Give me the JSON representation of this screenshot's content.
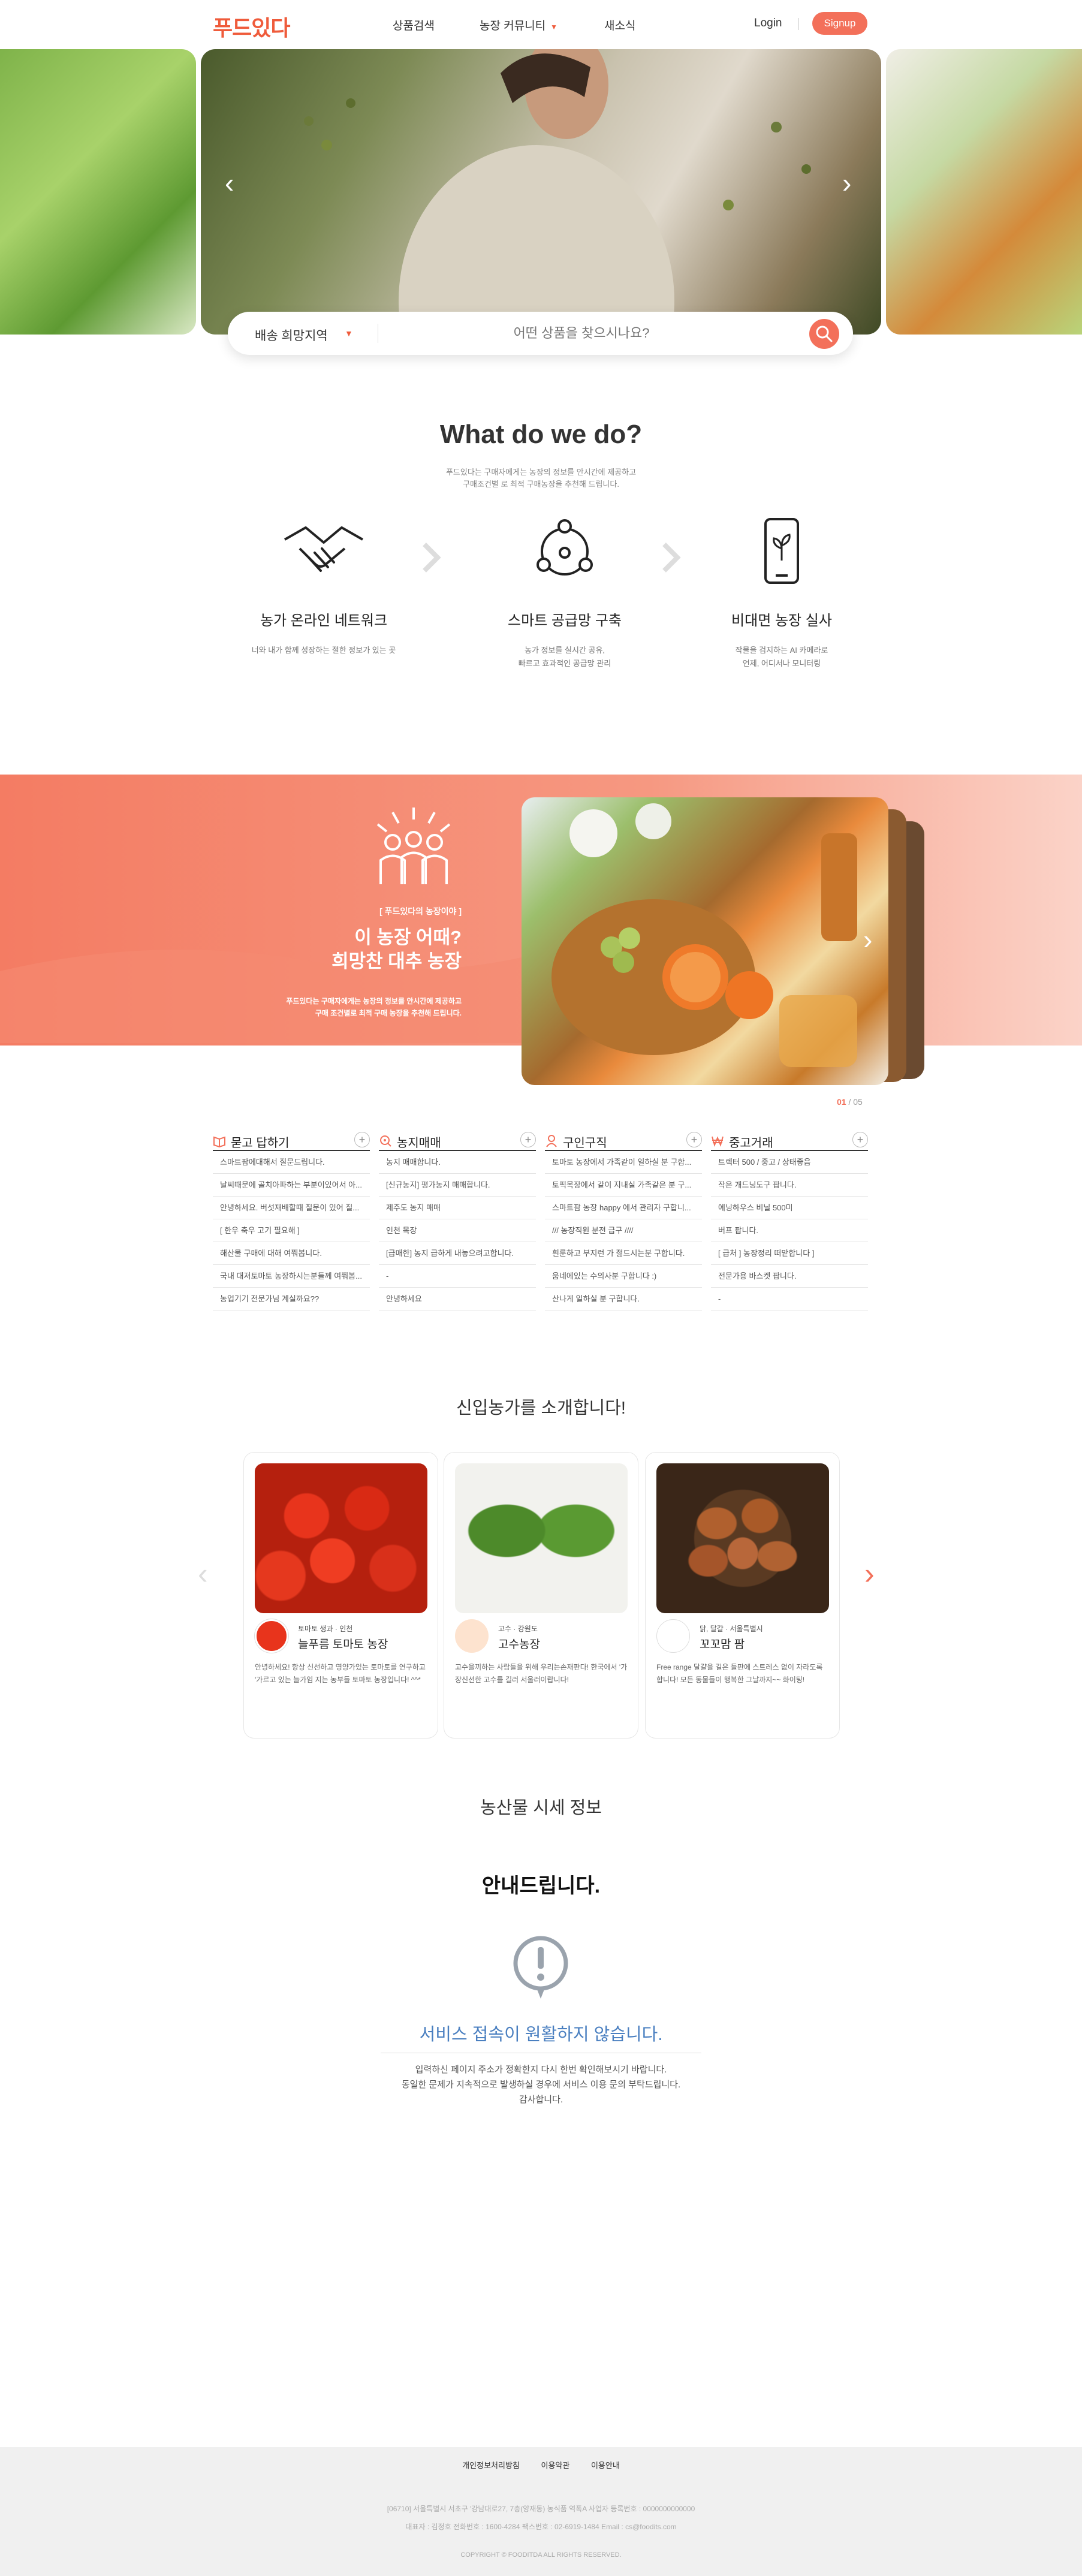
{
  "header": {
    "logo": "푸드있다",
    "nav": [
      "상품검색",
      "농장 커뮤니티",
      "새소식"
    ],
    "nav_caret": "▼",
    "login": "Login",
    "signup": "Signup"
  },
  "hero": {
    "prev_arrow": "‹",
    "next_arrow": "›"
  },
  "search": {
    "region_label": "배송 희망지역",
    "region_caret": "▼",
    "placeholder": "어떤 상품을 찾으시나요?"
  },
  "what_we_do": {
    "title": "What do we do?",
    "subtitle_line1": "푸드있다는 구매자에게는 농장의 정보를 안시간에 제공하고",
    "subtitle_line2": "구매조건별 로 최적 구매농장을 추천해 드립니다.",
    "features": [
      {
        "title": "농가 온라인 네트워크",
        "desc_line1": "너와 내가 함께 성장하는 절한 정보가 있는 곳",
        "desc_line2": ""
      },
      {
        "title": "스마트 공급망 구축",
        "desc_line1": "농가 정보를 실시간 공유,",
        "desc_line2": "빠르고 효과적인 공급망 관리"
      },
      {
        "title": "비대면 농장 실사",
        "desc_line1": "작물을 검지하는 AI 카메라로",
        "desc_line2": "언제, 어디서나 모니터링"
      }
    ]
  },
  "banner": {
    "tag": "[ 푸드있다의 농장이야 ]",
    "title_line1": "이 농장 어때?",
    "title_line2": "희망찬 대추 농장",
    "desc_line1": "푸드있다는 구매자에게는 농장의 정보를 안시간에 제공하고",
    "desc_line2": "구매 조건별로 최적 구매 농장을 추천해 드립니다.",
    "next_arrow": "›",
    "pager_current": "01",
    "pager_total": " / 05"
  },
  "boards": [
    {
      "title": "묻고 답하기",
      "color": "#f3705a",
      "rows": [
        "스마트팜에대해서 질문드립니다.",
        "날씨때문에 골치아파하는 부분이있어서 아...",
        "안녕하세요. 버섯재배할때 질문이 있어 질...",
        "[ 한우 축우 고기 필요해 ]",
        "해산물 구매에 대해 여쭤봅니다.",
        "국내 대저토마토 농장하시는분들께 여쭤봅...",
        "농업기기 전문가님 계실까요??"
      ]
    },
    {
      "title": "농지매매",
      "color": "#f3705a",
      "rows": [
        "농지 매매합니다.",
        "[신규농지] 평가농지 매매합니다.",
        "제주도 농지 매매",
        "인천 목장",
        "[급매한] 농지 급하게 내놓으려고합니다.",
        "-",
        "안녕하세요"
      ]
    },
    {
      "title": "구인구직",
      "color": "#f3705a",
      "rows": [
        "토마토 농장에서 가족같이 일하실 분 구합...",
        "토픽목장에서 같이 지내실 가족같은 분 구...",
        "스마트팜 농장 happy 에서 관리자 구합니...",
        "/// 농장직원 분전 급구 ////",
        "흰룬하고 부지런 가 젊드시는분 구합니다.",
        "움네에있는 수의사분 구합니다 :)",
        "산나게 일하실 분 구합니다."
      ]
    },
    {
      "title": "중고거래",
      "color": "#f3705a",
      "rows": [
        "트렉터 500 / 중고 / 상태좋음",
        "작은 개드닝도구 팝니다.",
        "에닝하우스 비닐 500미",
        "버프 팝니다.",
        "[ 급처 ] 농장정리 떠맡합니다 ]",
        "전문가용 바스켓 팝니다.",
        "-"
      ]
    }
  ],
  "new_farms": {
    "title": "신입농가를 소개합니다!",
    "prev_arrow": "‹",
    "next_arrow": "›",
    "cards": [
      {
        "meta": "토마토 생과 · 인천",
        "name": "늘푸름 토마토 농장",
        "desc": "안녕하세요! 항상 신선하고 영양가있는 토마토를 연구하고 '가르고 있는 늘가임 지는 농부들 토마토 농장입니다! ^^*"
      },
      {
        "meta": "고수 · 강원도",
        "name": "고수농장",
        "desc": "고수을끼하는 사람들을 위해 우리는손재판다! 한국에서 '가장신선한 고수를 길러 서울러이랍니다!"
      },
      {
        "meta": "닭, 달걀 · 서울특별시",
        "name": "꼬꼬맘 팜",
        "desc": "Free range 달걀을 길은 들판에 스트레스 없이 자라도록 합니다! 모든 동물들이 행복한 그날까지~~ 화이팅!"
      }
    ]
  },
  "price_info": {
    "title": "농산물 시세 정보",
    "notice_title": "안내드립니다.",
    "notice_msg": "서비스 접속이 원활하지 않습니다.",
    "desc_line1": "입력하신 페이지 주소가 정확한지 다시 한번 확인해보시기 바랍니다.",
    "desc_line2": "동일한 문제가 지속적으로 발생하실 경우에 서비스 이용 문의 부탁드립니다.",
    "desc_line3": "감사합니다."
  },
  "footer": {
    "links": [
      "개인정보처리방침",
      "이용약관",
      "이용안내"
    ],
    "address": "[06710] 서울특별시 서초구 '강남대로27, 7층(양재동) 농식품 역폭A     사업자 등록번호 : 0000000000000",
    "contact": "대표자 : 김정호     전화번호 : 1600-4284     팩스번호 : 02-6919-1484     Email : cs@foodits.com",
    "copyright": "COPYRIGHT © FOODITDA ALL RIGHTS RESERVED."
  },
  "colors": {
    "accent": "#f3705a",
    "notice_blue": "#4a7fc0"
  }
}
